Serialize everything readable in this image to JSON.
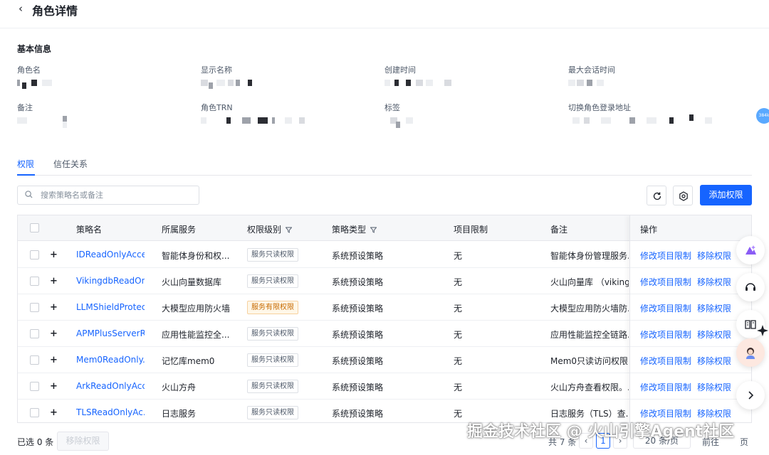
{
  "header": {
    "back_icon": "chevron-left-icon",
    "title": "角色详情"
  },
  "basic_info": {
    "title": "基本信息",
    "fields": [
      {
        "label": "角色名"
      },
      {
        "label": "显示名称"
      },
      {
        "label": "创建时间"
      },
      {
        "label": "最大会话时间"
      },
      {
        "label": "备注"
      },
      {
        "label": "角色TRN"
      },
      {
        "label": "标签"
      },
      {
        "label": "切换角色登录地址"
      }
    ]
  },
  "tabs": [
    {
      "label": "权限",
      "active": true
    },
    {
      "label": "信任关系",
      "active": false
    }
  ],
  "toolbar": {
    "search_placeholder": "搜索策略名或备注",
    "refresh_icon": "refresh-icon",
    "settings_icon": "gear-icon",
    "add_label": "添加权限"
  },
  "table": {
    "columns": [
      "策略名",
      "所属服务",
      "权限级别",
      "策略类型",
      "项目限制",
      "备注",
      "操作"
    ],
    "rows": [
      {
        "name": "IDReadOnlyAcce...",
        "service": "智能体身份和权...",
        "level": "服务只读权限",
        "level_type": "readonly",
        "type": "系统预设策略",
        "project": "无",
        "note": "智能体身份管理服务...",
        "op1": "修改项目限制",
        "op2": "移除权限"
      },
      {
        "name": "VikingdbReadOnl...",
        "service": "火山向量数据库",
        "level": "服务只读权限",
        "level_type": "readonly",
        "type": "系统预设策略",
        "project": "无",
        "note": "火山向量库 （viking...",
        "op1": "修改项目限制",
        "op2": "移除权限"
      },
      {
        "name": "LLMShieldProtec...",
        "service": "大模型应用防火墙",
        "level": "服务有限权限",
        "level_type": "limited",
        "type": "系统预设策略",
        "project": "无",
        "note": "大模型应用防火墙防...",
        "op1": "修改项目限制",
        "op2": "移除权限"
      },
      {
        "name": "APMPlusServerR...",
        "service": "应用性能监控全...",
        "level": "服务只读权限",
        "level_type": "readonly",
        "type": "系统预设策略",
        "project": "无",
        "note": "应用性能监控全链路...",
        "op1": "修改项目限制",
        "op2": "移除权限"
      },
      {
        "name": "Mem0ReadOnly...",
        "service": "记忆库mem0",
        "level": "服务只读权限",
        "level_type": "readonly",
        "type": "系统预设策略",
        "project": "无",
        "note": "Mem0只读访问权限",
        "op1": "修改项目限制",
        "op2": "移除权限"
      },
      {
        "name": "ArkReadOnlyAcc...",
        "service": "火山方舟",
        "level": "服务只读权限",
        "level_type": "readonly",
        "type": "系统预设策略",
        "project": "无",
        "note": "火山方舟查看权限。...",
        "op1": "修改项目限制",
        "op2": "移除权限"
      },
      {
        "name": "TLSReadOnlyAc...",
        "service": "日志服务",
        "level": "服务只读权限",
        "level_type": "readonly",
        "type": "系统预设策略",
        "project": "无",
        "note": "日志服务（TLS）查...",
        "op1": "修改项目限制",
        "op2": "移除权限"
      }
    ]
  },
  "footer": {
    "selected": "已选 0 条",
    "remove_label": "移除权限",
    "total": "共 7 条",
    "current_page": "1",
    "page_size": "20 条/页",
    "goto": "前往",
    "page_unit": "页"
  },
  "side_tools": [
    "ai-assistant-icon",
    "customer-service-icon",
    "docs-icon",
    "avatar",
    "expand-icon"
  ],
  "side_badge": "384k",
  "watermark": "掘金技术社区 @ 火山引擎Agent社区",
  "colors": {
    "primary": "#1664ff",
    "warn_tag": "#c76a00"
  }
}
